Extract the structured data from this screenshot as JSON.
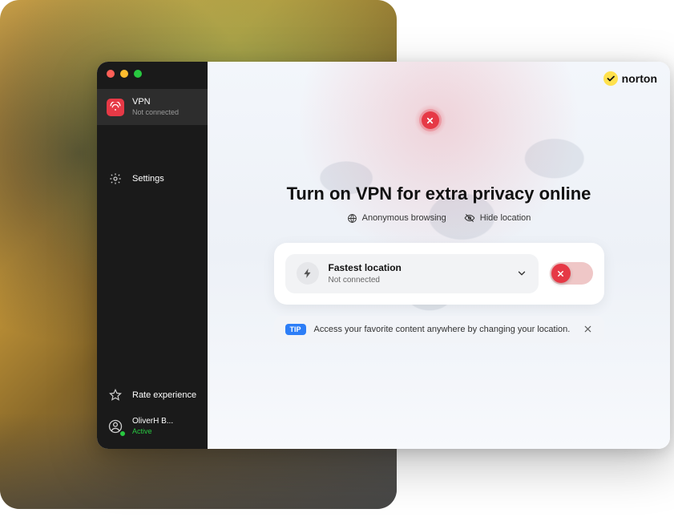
{
  "brand": {
    "name": "norton"
  },
  "sidebar": {
    "vpn": {
      "title": "VPN",
      "status": "Not connected"
    },
    "settings": {
      "label": "Settings"
    },
    "rate": {
      "label": "Rate experience"
    },
    "user": {
      "name": "OliverH B...",
      "status": "Active"
    }
  },
  "main": {
    "headline": "Turn on VPN for extra privacy online",
    "tags": {
      "anon": "Anonymous browsing",
      "hide": "Hide location"
    },
    "selector": {
      "title": "Fastest location",
      "status": "Not connected"
    },
    "tip": {
      "badge": "TIP",
      "text": "Access your favorite content anywhere by changing your location."
    }
  },
  "colors": {
    "accent": "#e63946",
    "brandYellow": "#ffe14d",
    "success": "#28c840",
    "tipBadge": "#2d7ef7"
  }
}
